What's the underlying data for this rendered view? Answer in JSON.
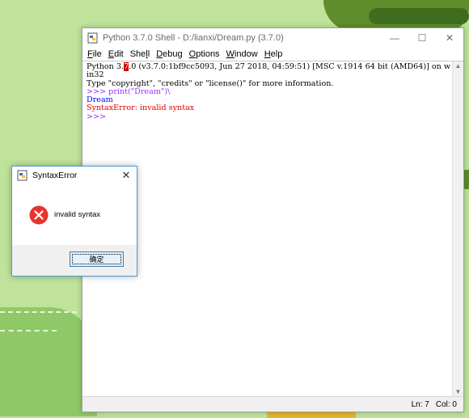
{
  "window": {
    "title": "Python 3.7.0 Shell - D:/lianxi/Dream.py (3.7.0)",
    "minimize": "—",
    "maximize": "☐",
    "close": "✕"
  },
  "menu": [
    {
      "label": "File",
      "underline": "F"
    },
    {
      "label": "Edit",
      "underline": "E"
    },
    {
      "label": "Shell",
      "underline": "S"
    },
    {
      "label": "Debug",
      "underline": "D"
    },
    {
      "label": "Options",
      "underline": "O"
    },
    {
      "label": "Window",
      "underline": "W"
    },
    {
      "label": "Help",
      "underline": "H"
    }
  ],
  "shell": {
    "banner_pre": "Python 3.",
    "banner_highlight": "7",
    "banner_post": ".0 (v3.7.0:1bf9cc5093, Jun 27 2018, 04:59:51) [MSC v.1914 64 bit (AMD64)] on win32",
    "banner_line2": "Type \"copyright\", \"credits\" or \"license()\" for more information.",
    "prompt1": ">>> ",
    "input1": "print(\"Dream\")\\",
    "output1": "Dream",
    "error_line": "SyntaxError: invalid syntax",
    "prompt2": ">>>"
  },
  "status": {
    "line": "Ln: 7",
    "col": "Col: 0"
  },
  "dialog": {
    "title": "SyntaxError",
    "message": "invalid syntax",
    "ok_label": "确定",
    "close": "✕"
  },
  "colors": {
    "error": "#e00000",
    "prompt": "#9b30ff",
    "dialog_border": "#4a9ad6"
  }
}
